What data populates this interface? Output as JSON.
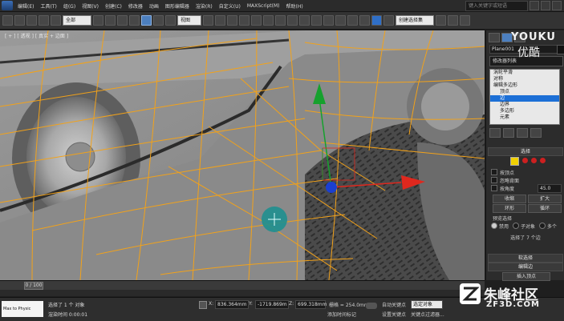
{
  "menu": {
    "items": [
      "编辑(E)",
      "工具(T)",
      "组(G)",
      "视图(V)",
      "创建(C)",
      "修改器",
      "动画",
      "图形编辑器",
      "渲染(R)",
      "自定义(U)",
      "MAXScript(M)",
      "帮助(H)"
    ],
    "search_placeholder": "键入关键字或短语"
  },
  "toolbar": {
    "filter_dropdown": "全部",
    "refcoord_dropdown": "视图",
    "selection_set": "创建选择集"
  },
  "viewport": {
    "label": "[ + ] [ 透视 ] [ 真实 + 边面 ]"
  },
  "command_panel": {
    "object_name": "Plane001",
    "modifier_list": "修改器列表",
    "stack": [
      {
        "label": "涡轮平滑",
        "selected": false
      },
      {
        "label": "对称",
        "selected": false
      },
      {
        "label": "编辑多边形",
        "selected": false
      },
      {
        "label": "顶点",
        "selected": false
      },
      {
        "label": "边",
        "selected": true
      },
      {
        "label": "边界",
        "selected": false
      },
      {
        "label": "多边形",
        "selected": false
      },
      {
        "label": "元素",
        "selected": false
      }
    ],
    "selection_section": "选择",
    "by_vertex": "按顶点",
    "ignore_backfacing": "忽略背面",
    "by_angle": "按角度",
    "angle_value": "45.0",
    "shrink": "收缩",
    "grow": "扩大",
    "ring": "环形",
    "loop": "循环",
    "preview_selection": "预览选择",
    "preview_off": "禁用",
    "preview_subobj": "子对象",
    "preview_multi": "多个",
    "selected_count": "选择了 7 个边",
    "soft_selection": "软选择",
    "edit_edges": "编辑边",
    "insert_vertex": "插入顶点"
  },
  "timeline": {
    "frame": "0 / 100"
  },
  "status": {
    "script_label": "Max to Physic",
    "selected_text": "选择了 1 个 对象",
    "prompt_text": "渲染时间 0:00:01",
    "x_value": "836.364mm",
    "y_value": "-1719.869m",
    "z_value": "699.318mm",
    "grid_value": "栅格 = 254.0mm",
    "add_time_tag": "添加时间标记",
    "auto_key": "自动关键点",
    "set_key": "设置关键点",
    "key_filter": "选定对象",
    "key_filters_btn": "关键点过滤器..."
  },
  "watermarks": {
    "youku_en": "YOUKU",
    "youku_cn": "优酷",
    "site_cn": "朱峰社区",
    "site_url": "ZF3D.COM"
  },
  "colors": {
    "wire": "#f2a21a",
    "gizmo_x": "#e0281e",
    "gizmo_y": "#16a12d",
    "gizmo_z": "#1b3fd1",
    "highlight": "#1c6fd6"
  }
}
